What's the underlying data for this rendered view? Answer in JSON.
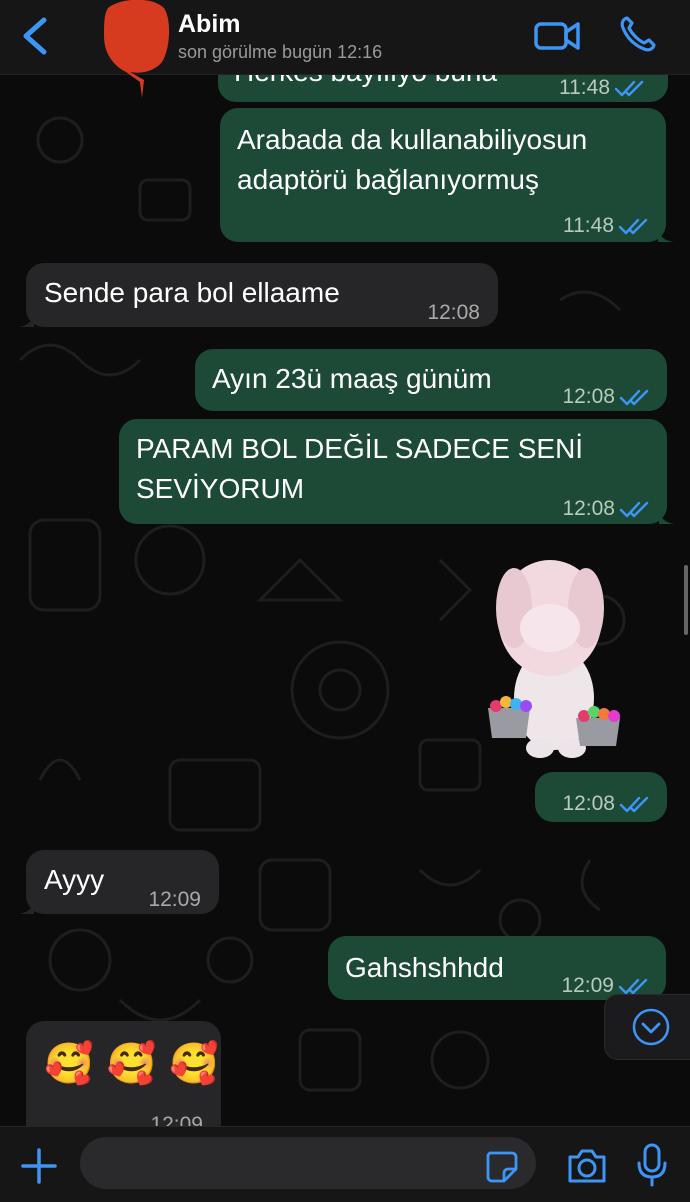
{
  "header": {
    "contact_name": "Abim",
    "status": "son görülme bugün 12:16"
  },
  "messages": [
    {
      "direction": "out",
      "text": "Herkes bayılıyo buna",
      "time": "11:48",
      "read": true
    },
    {
      "direction": "out",
      "lines": [
        "Arabada da kullanabiliyosun",
        "adaptörü bağlanıyormuş"
      ],
      "time": "11:48",
      "read": true
    },
    {
      "direction": "in",
      "text": "Sende para bol ellaame",
      "time": "12:08"
    },
    {
      "direction": "out",
      "text": "Ayın 23ü maaş günüm",
      "time": "12:08",
      "read": true
    },
    {
      "direction": "out",
      "lines": [
        "PARAM BOL DEĞİL SADECE SENİ",
        "SEVİYORUM"
      ],
      "time": "12:08",
      "read": true
    },
    {
      "direction": "out",
      "type": "sticker",
      "sticker": "white-bunny-with-heart-buckets",
      "time": "12:08",
      "read": true
    },
    {
      "direction": "in",
      "text": "Ayyy",
      "time": "12:09"
    },
    {
      "direction": "out",
      "text": "Gahshshhdd",
      "time": "12:09",
      "read": true
    },
    {
      "direction": "in",
      "type": "emoji",
      "text": "🥰 🥰 🥰",
      "time": "12:09"
    }
  ],
  "composer": {
    "placeholder": ""
  },
  "colors": {
    "outgoing_bubble": "#1d4a37",
    "incoming_bubble": "#262628",
    "accent": "#3d95f5",
    "redaction": "#d63a1f"
  },
  "icons": {
    "back": "chevron-left-icon",
    "video": "video-camera-icon",
    "call": "phone-icon",
    "ticks": "double-check-icon",
    "scroll": "chevron-down-circle-icon",
    "plus": "plus-icon",
    "sticker": "sticker-icon",
    "camera": "camera-icon",
    "mic": "microphone-icon"
  }
}
